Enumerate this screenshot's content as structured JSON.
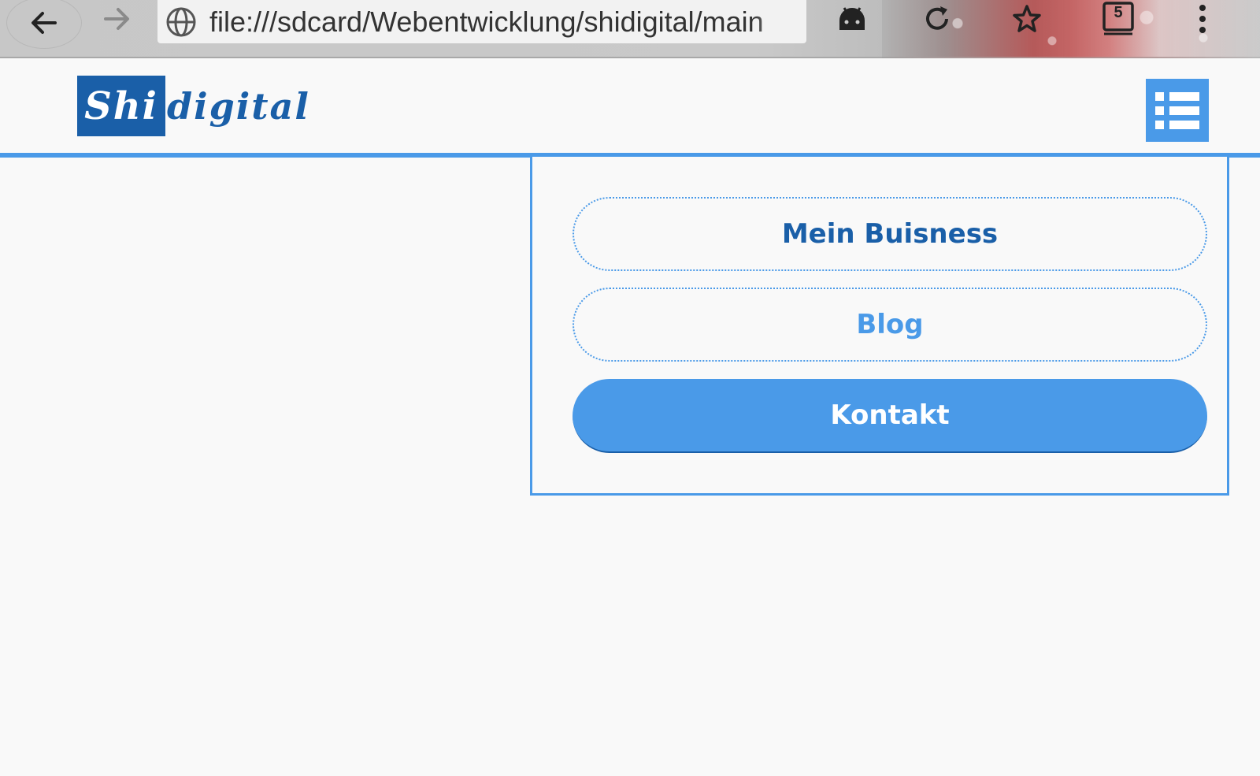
{
  "browser": {
    "url": "file:///sdcard/Webentwicklung/shidigital/main",
    "tab_count": "5",
    "icons": [
      "back-arrow-icon",
      "forward-arrow-icon",
      "globe-icon",
      "android-icon",
      "reload-icon",
      "star-icon",
      "tabs-icon",
      "overflow-menu-icon"
    ]
  },
  "site": {
    "logo_part1": "Shi",
    "logo_part2": "digital",
    "menu_icon": "hamburger-list-icon",
    "nav": {
      "items": [
        {
          "label": "Mein Buisness",
          "style": "outline"
        },
        {
          "label": "Blog",
          "style": "outline"
        },
        {
          "label": "Kontakt",
          "style": "filled"
        }
      ]
    }
  },
  "colors": {
    "brand_dark": "#1a5fa8",
    "accent": "#4a9ae8",
    "background": "#f9f9f9"
  }
}
